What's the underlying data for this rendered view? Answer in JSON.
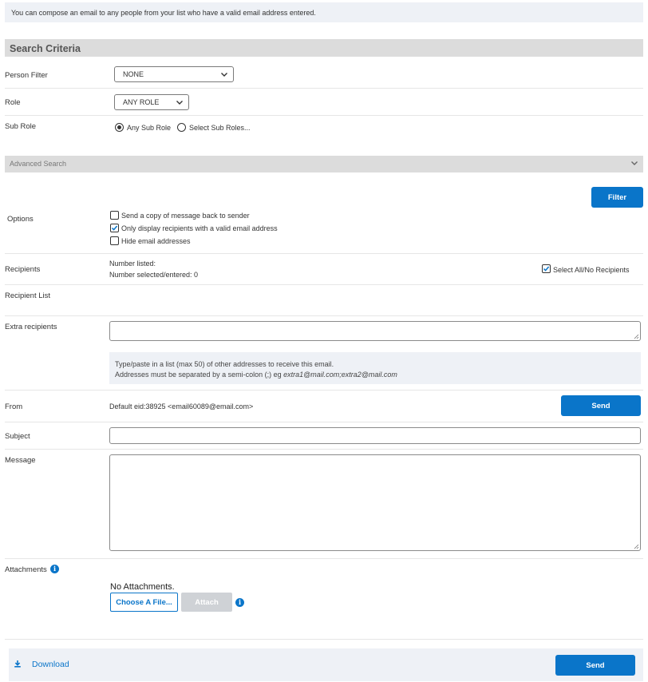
{
  "info": {
    "text": "You can compose an email to any people from your list who have a valid email address entered."
  },
  "search": {
    "title": "Search Criteria",
    "person_filter": {
      "label": "Person Filter",
      "value": "NONE"
    },
    "role": {
      "label": "Role",
      "value": "ANY ROLE"
    },
    "sub_role": {
      "label": "Sub Role",
      "option_any": "Any Sub Role",
      "option_select": "Select Sub Roles..."
    }
  },
  "advanced": {
    "title": "Advanced Search"
  },
  "filter_button": "Filter",
  "options": {
    "label": "Options",
    "copy_sender": {
      "label": "Send a copy of message back to sender",
      "checked": false
    },
    "valid_only": {
      "label": "Only display recipients with a valid email address",
      "checked": true
    },
    "hide_emails": {
      "label": "Hide email addresses",
      "checked": false
    }
  },
  "recipients": {
    "label": "Recipients",
    "number_listed": "Number listed:",
    "number_selected": "Number selected/entered: 0",
    "select_all": {
      "label": "Select All/No Recipients",
      "checked": true
    }
  },
  "recipient_list": {
    "label": "Recipient List"
  },
  "extra": {
    "label": "Extra recipients",
    "help_line1": "Type/paste in a list (max 50) of other addresses to receive this email.",
    "help_line2_prefix": "Addresses must be separated by a semi-colon (;) eg ",
    "help_line2_example": "extra1@mail.com;extra2@mail.com"
  },
  "from": {
    "label": "From",
    "value": "Default eid:38925 <email60089@email.com>",
    "send_label": "Send"
  },
  "subject": {
    "label": "Subject",
    "value": ""
  },
  "message": {
    "label": "Message",
    "value": ""
  },
  "attachments": {
    "label": "Attachments",
    "status": "No Attachments.",
    "choose_label": "Choose A File...",
    "attach_label": "Attach"
  },
  "footer": {
    "download_label": "Download",
    "send_label": "Send"
  },
  "colors": {
    "accent": "#0a75c9",
    "section_bg": "#dcdcdc",
    "info_bg": "#eef1f6"
  }
}
